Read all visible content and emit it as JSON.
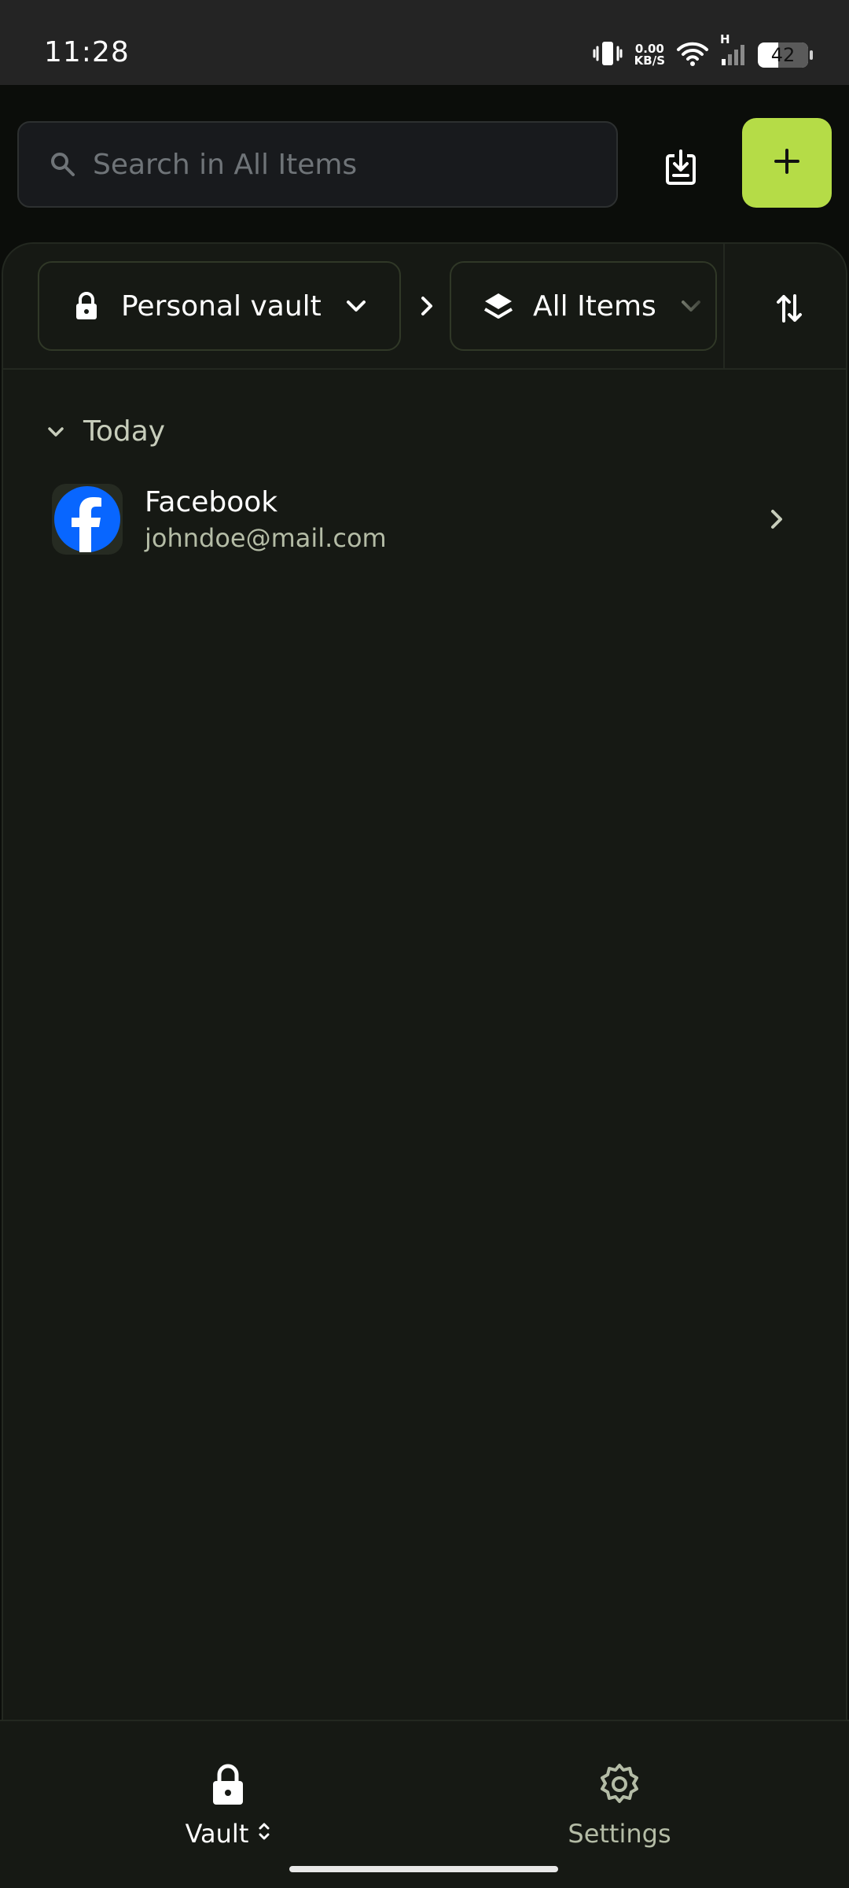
{
  "status_bar": {
    "time": "11:28",
    "net_speed_value": "0.00",
    "net_speed_unit": "KB/S",
    "network_type": "H",
    "battery_level": "42"
  },
  "search": {
    "placeholder": "Search in All Items"
  },
  "filters": {
    "vault_label": "Personal vault",
    "items_label": "All Items"
  },
  "section": {
    "title": "Today"
  },
  "items": [
    {
      "title": "Facebook",
      "subtitle": "johndoe@mail.com",
      "icon": "facebook-logo"
    }
  ],
  "bottom_nav": {
    "vault_label": "Vault",
    "settings_label": "Settings"
  },
  "colors": {
    "accent": "#b5dc47",
    "background": "#0b0d0a",
    "panel": "#161914",
    "facebook_blue": "#0866ff"
  }
}
